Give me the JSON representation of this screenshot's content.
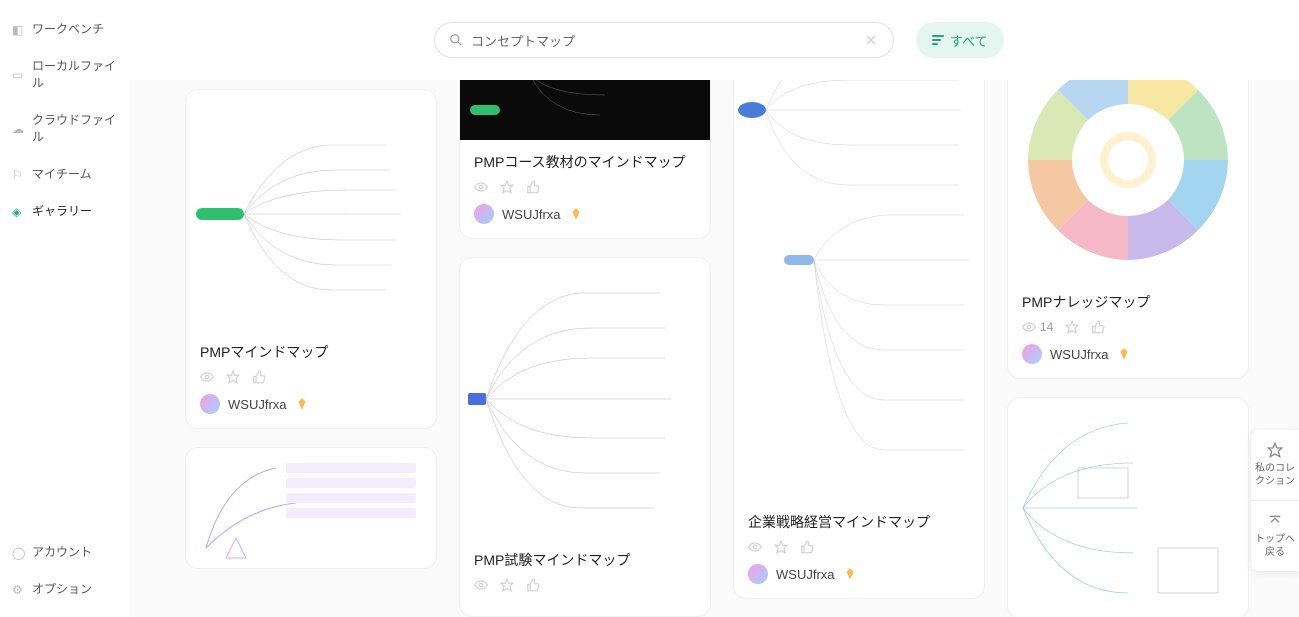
{
  "sidebar": {
    "top": [
      {
        "label": "ワークベンチ"
      },
      {
        "label": "ローカルファイル"
      },
      {
        "label": "クラウドファイル"
      },
      {
        "label": "マイチーム"
      },
      {
        "label": "ギャラリー",
        "active": true
      }
    ],
    "bottom": [
      {
        "label": "アカウント"
      },
      {
        "label": "オプション"
      }
    ]
  },
  "search": {
    "value": "コンセプトマップ"
  },
  "filter": {
    "label": "すべて"
  },
  "floating": {
    "fav": "私のコレクション",
    "top": "トップへ戻る"
  },
  "cards": {
    "c1_author": "WSUJfrxa",
    "c2_title": "PMPマインドマップ",
    "c2_author": "WSUJfrxa",
    "c3_title": "PMPコース教材のマインドマップ",
    "c3_author": "WSUJfrxa",
    "c4_title": "PMP試験マインドマップ",
    "c5_title": "企業戦略経営マインドマップ",
    "c5_author": "WSUJfrxa",
    "c6_title": "PMPナレッジマップ",
    "c6_views": "14",
    "c6_author": "WSUJfrxa"
  }
}
